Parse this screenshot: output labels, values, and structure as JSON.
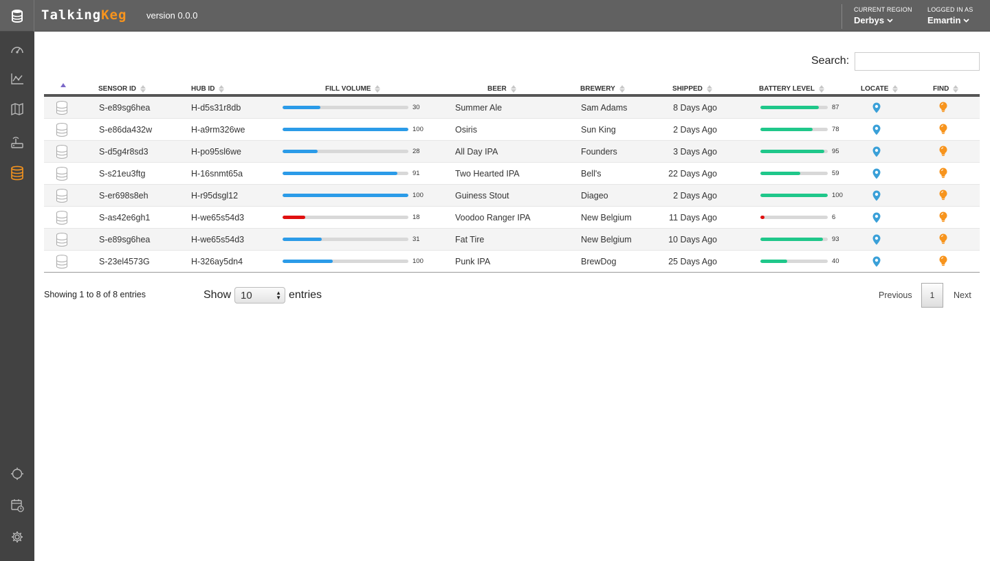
{
  "app": {
    "brand_part1": "Talking",
    "brand_part2": "Keg",
    "version": "version 0.0.0",
    "brand_color": "#f7941d"
  },
  "header": {
    "region_caption": "CURRENT REGION",
    "region_value": "Derbys",
    "login_caption": "LOGGED IN AS",
    "login_value": "Emartin"
  },
  "sidebar": {
    "items": [
      {
        "icon": "dashboard-gauge-icon",
        "active": false
      },
      {
        "icon": "line-chart-icon",
        "active": false
      },
      {
        "icon": "map-icon",
        "active": false
      },
      {
        "icon": "router-icon",
        "active": false
      },
      {
        "icon": "keg-barrel-icon",
        "active": true
      }
    ],
    "bottom_items": [
      {
        "icon": "support-icon"
      },
      {
        "icon": "calendar-clock-icon"
      },
      {
        "icon": "settings-gear-icon"
      }
    ]
  },
  "search": {
    "label": "Search:",
    "value": ""
  },
  "table": {
    "columns": [
      "",
      "SENSOR ID",
      "HUB ID",
      "FILL VOLUME",
      "BEER",
      "BREWERY",
      "SHIPPED",
      "BATTERY LEVEL",
      "LOCATE",
      "FIND"
    ],
    "rows": [
      {
        "sensor": "S-e89sg6hea",
        "hub": "H-d5s31r8db",
        "fill": 30,
        "fill_label": "30",
        "beer": "Summer Ale",
        "brewery": "Sam Adams",
        "shipped": "8 Days Ago",
        "battery": 87,
        "battery_label": "87"
      },
      {
        "sensor": "S-e86da432w",
        "hub": "H-a9rm326we",
        "fill": 100,
        "fill_label": "100",
        "beer": "Osiris",
        "brewery": "Sun King",
        "shipped": "2 Days Ago",
        "battery": 78,
        "battery_label": "78"
      },
      {
        "sensor": "S-d5g4r8sd3",
        "hub": "H-po95sl6we",
        "fill": 28,
        "fill_label": "28",
        "beer": "All Day IPA",
        "brewery": "Founders",
        "shipped": "3 Days Ago",
        "battery": 95,
        "battery_label": "95"
      },
      {
        "sensor": "S-s21eu3ftg",
        "hub": "H-16snmt65a",
        "fill": 91,
        "fill_label": "91",
        "beer": "Two Hearted IPA",
        "brewery": "Bell's",
        "shipped": "22 Days Ago",
        "battery": 59,
        "battery_label": "59"
      },
      {
        "sensor": "S-er698s8eh",
        "hub": "H-r95dsgl12",
        "fill": 100,
        "fill_label": "100",
        "beer": "Guiness Stout",
        "brewery": "Diageo",
        "shipped": "2 Days Ago",
        "battery": 100,
        "battery_label": "100"
      },
      {
        "sensor": "S-as42e6gh1",
        "hub": "H-we65s54d3",
        "fill": 18,
        "fill_label": "18",
        "beer": "Voodoo Ranger IPA",
        "brewery": "New Belgium",
        "shipped": "11 Days Ago",
        "battery": 6,
        "battery_label": "6"
      },
      {
        "sensor": "S-e89sg6hea",
        "hub": "H-we65s54d3",
        "fill": 31,
        "fill_label": "31",
        "beer": "Fat Tire",
        "brewery": "New Belgium",
        "shipped": "10 Days Ago",
        "battery": 93,
        "battery_label": "93"
      },
      {
        "sensor": "S-23el4573G",
        "hub": "H-326ay5dn4",
        "fill": 40,
        "fill_label": "100",
        "beer": "Punk IPA",
        "brewery": "BrewDog",
        "shipped": "25 Days Ago",
        "battery": 40,
        "battery_label": "40"
      }
    ]
  },
  "colors": {
    "fill_ok": "#2b9be8",
    "fill_low": "#e01010",
    "battery_ok": "#1fc78a",
    "battery_low": "#e01010",
    "locate_pin": "#3aa0d8",
    "find_bulb": "#f7941d"
  },
  "footer": {
    "showing": "Showing 1 to 8 of 8 entries",
    "show_label": "Show",
    "page_size": "10",
    "entries_label": "entries",
    "prev": "Previous",
    "current_page": "1",
    "next": "Next"
  }
}
